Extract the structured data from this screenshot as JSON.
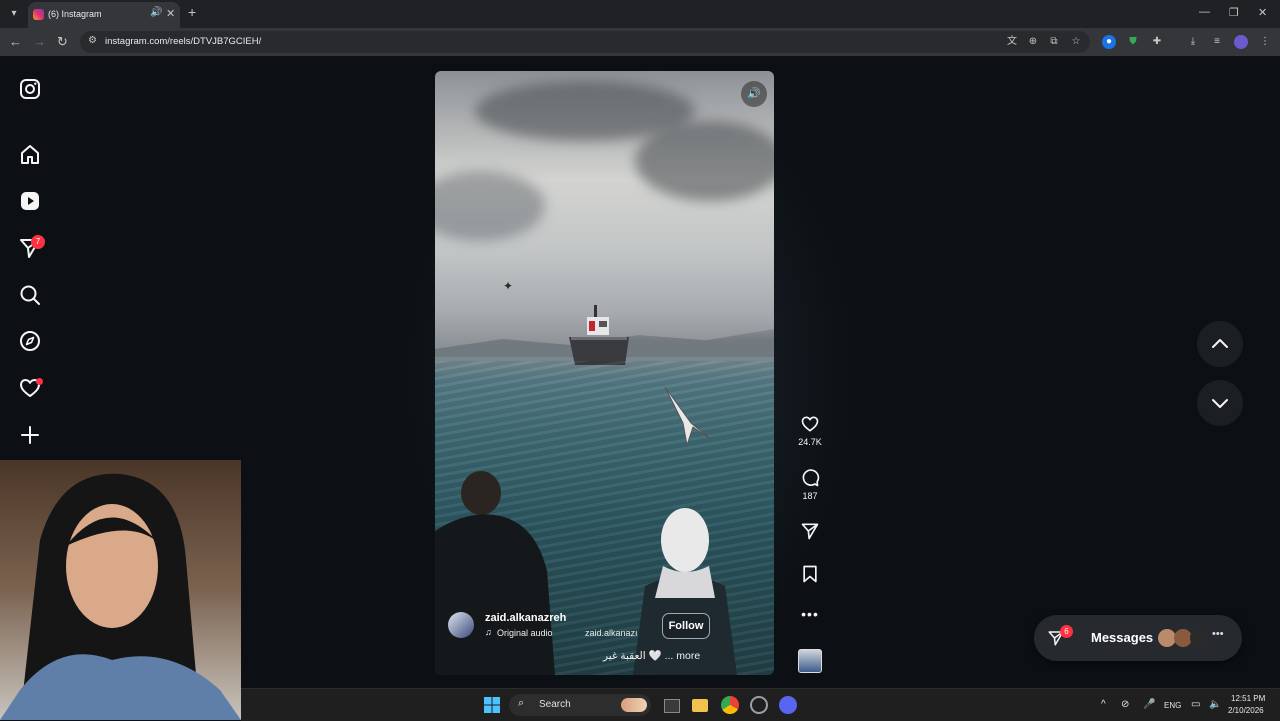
{
  "browser": {
    "tab_title": "(6) Instagram",
    "url": "instagram.com/reels/DTVJB7GCIEH/"
  },
  "sidebar": {
    "notifications_badge": "7"
  },
  "reel": {
    "username": "zaid.alkanazreh",
    "audio_label": "Original audio",
    "audio_author": "zaid.alkanazı",
    "follow_label": "Follow",
    "caption": "العقبة غير 🤍 ... more",
    "likes": "24.7K",
    "comments": "187"
  },
  "messages": {
    "label": "Messages",
    "badge": "6"
  },
  "taskbar": {
    "search_label": "Search",
    "language": "ENG",
    "time": "12:51 PM",
    "date": "2/10/2026"
  },
  "colors": {
    "background": "#0c1014",
    "badge": "#ff3040",
    "chrome_dark": "#202124",
    "chrome_toolbar": "#35363a"
  }
}
